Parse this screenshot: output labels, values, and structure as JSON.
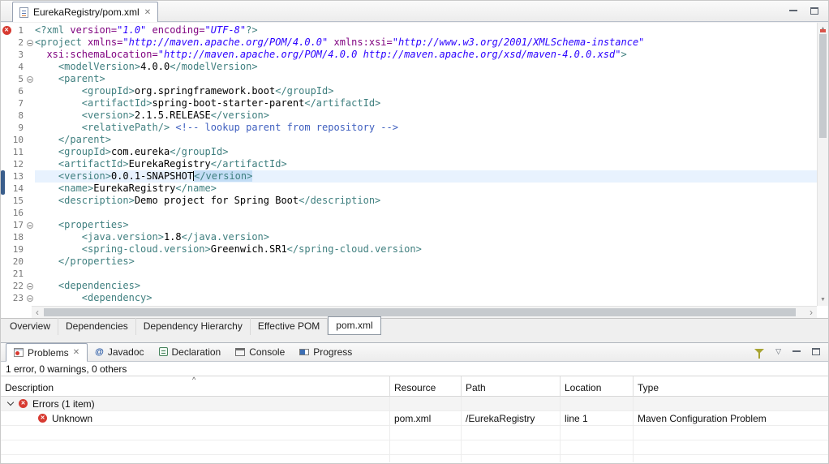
{
  "glyphs": {
    "close": "✕",
    "cross": "✕",
    "up_arrow": "▲",
    "down_arrow": "▼",
    "left_arrow": "‹",
    "right_arrow": "›",
    "sort_asc": "^",
    "at": "@",
    "view_menu": "▽"
  },
  "colors": {
    "tag": "#3F7F7F",
    "attr_name": "#7F007F",
    "attr_value": "#2A00FF",
    "comment": "#3F5FBF",
    "text": "#000000",
    "error": "#d73a31",
    "current_line": "#e8f2fe",
    "occurrence_highlight": "#c3ddf5"
  },
  "editor": {
    "tab_title": "EurekaRegistry/pom.xml",
    "lines": [
      {
        "num": 1,
        "error": true,
        "segments": [
          [
            "t",
            "<?xml "
          ],
          [
            "a",
            "version="
          ],
          [
            "v",
            "\"1.0\""
          ],
          [
            "x",
            " "
          ],
          [
            "a",
            "encoding="
          ],
          [
            "v",
            "\"UTF-8\""
          ],
          [
            "t",
            "?>"
          ]
        ]
      },
      {
        "num": 2,
        "fold": true,
        "segments": [
          [
            "t",
            "<project "
          ],
          [
            "a",
            "xmlns="
          ],
          [
            "v",
            "\"http://maven.apache.org/POM/4.0.0\""
          ],
          [
            "x",
            " "
          ],
          [
            "a",
            "xmlns:xsi="
          ],
          [
            "v",
            "\"http://www.w3.org/2001/XMLSchema-instance\""
          ]
        ]
      },
      {
        "num": 3,
        "segments": [
          [
            "x",
            "  "
          ],
          [
            "a",
            "xsi:schemaLocation="
          ],
          [
            "v",
            "\"http://maven.apache.org/POM/4.0.0 http://maven.apache.org/xsd/maven-4.0.0.xsd\""
          ],
          [
            "t",
            ">"
          ]
        ]
      },
      {
        "num": 4,
        "segments": [
          [
            "x",
            "    "
          ],
          [
            "t",
            "<modelVersion>"
          ],
          [
            "x",
            "4.0.0"
          ],
          [
            "t",
            "</modelVersion>"
          ]
        ]
      },
      {
        "num": 5,
        "fold": true,
        "segments": [
          [
            "x",
            "    "
          ],
          [
            "t",
            "<parent>"
          ]
        ]
      },
      {
        "num": 6,
        "segments": [
          [
            "x",
            "        "
          ],
          [
            "t",
            "<groupId>"
          ],
          [
            "x",
            "org.springframework.boot"
          ],
          [
            "t",
            "</groupId>"
          ]
        ]
      },
      {
        "num": 7,
        "segments": [
          [
            "x",
            "        "
          ],
          [
            "t",
            "<artifactId>"
          ],
          [
            "x",
            "spring-boot-starter-parent"
          ],
          [
            "t",
            "</artifactId>"
          ]
        ]
      },
      {
        "num": 8,
        "segments": [
          [
            "x",
            "        "
          ],
          [
            "t",
            "<version>"
          ],
          [
            "x",
            "2.1.5.RELEASE"
          ],
          [
            "t",
            "</version>"
          ]
        ]
      },
      {
        "num": 9,
        "segments": [
          [
            "x",
            "        "
          ],
          [
            "t",
            "<relativePath/>"
          ],
          [
            "x",
            " "
          ],
          [
            "c",
            "<!-- lookup parent from repository -->"
          ]
        ]
      },
      {
        "num": 10,
        "segments": [
          [
            "x",
            "    "
          ],
          [
            "t",
            "</parent>"
          ]
        ]
      },
      {
        "num": 11,
        "segments": [
          [
            "x",
            "    "
          ],
          [
            "t",
            "<groupId>"
          ],
          [
            "x",
            "com.eureka"
          ],
          [
            "t",
            "</groupId>"
          ]
        ]
      },
      {
        "num": 12,
        "segments": [
          [
            "x",
            "    "
          ],
          [
            "t",
            "<artifactId>"
          ],
          [
            "x",
            "EurekaRegistry"
          ],
          [
            "t",
            "</artifactId>"
          ]
        ]
      },
      {
        "num": 13,
        "current": true,
        "segments": [
          [
            "x",
            "    "
          ],
          [
            "t",
            "<version>"
          ],
          [
            "x",
            "0.0.1-SNAPSHOT"
          ],
          [
            "cursor",
            ""
          ],
          [
            "th",
            "</version>"
          ]
        ]
      },
      {
        "num": 14,
        "segments": [
          [
            "x",
            "    "
          ],
          [
            "t",
            "<name>"
          ],
          [
            "x",
            "EurekaRegistry"
          ],
          [
            "t",
            "</name>"
          ]
        ]
      },
      {
        "num": 15,
        "segments": [
          [
            "x",
            "    "
          ],
          [
            "t",
            "<description>"
          ],
          [
            "x",
            "Demo project for Spring Boot"
          ],
          [
            "t",
            "</description>"
          ]
        ]
      },
      {
        "num": 16,
        "segments": []
      },
      {
        "num": 17,
        "fold": true,
        "segments": [
          [
            "x",
            "    "
          ],
          [
            "t",
            "<properties>"
          ]
        ]
      },
      {
        "num": 18,
        "segments": [
          [
            "x",
            "        "
          ],
          [
            "t",
            "<java.version>"
          ],
          [
            "x",
            "1.8"
          ],
          [
            "t",
            "</java.version>"
          ]
        ]
      },
      {
        "num": 19,
        "segments": [
          [
            "x",
            "        "
          ],
          [
            "t",
            "<spring-cloud.version>"
          ],
          [
            "x",
            "Greenwich.SR1"
          ],
          [
            "t",
            "</spring-cloud.version>"
          ]
        ]
      },
      {
        "num": 20,
        "segments": [
          [
            "x",
            "    "
          ],
          [
            "t",
            "</properties>"
          ]
        ]
      },
      {
        "num": 21,
        "segments": []
      },
      {
        "num": 22,
        "fold": true,
        "segments": [
          [
            "x",
            "    "
          ],
          [
            "t",
            "<dependencies>"
          ]
        ]
      },
      {
        "num": 23,
        "fold": true,
        "segments": [
          [
            "x",
            "        "
          ],
          [
            "t",
            "<dependency>"
          ]
        ]
      }
    ]
  },
  "editor_bottom_tabs": {
    "items": [
      {
        "label": "Overview"
      },
      {
        "label": "Dependencies"
      },
      {
        "label": "Dependency Hierarchy"
      },
      {
        "label": "Effective POM"
      },
      {
        "label": "pom.xml",
        "selected": true
      }
    ]
  },
  "problems_view": {
    "tabs": [
      {
        "label": "Problems",
        "selected": true
      },
      {
        "label": "Javadoc"
      },
      {
        "label": "Declaration"
      },
      {
        "label": "Console"
      },
      {
        "label": "Progress"
      }
    ],
    "summary": "1 error, 0 warnings, 0 others",
    "columns": [
      {
        "label": "Description"
      },
      {
        "label": "Resource"
      },
      {
        "label": "Path"
      },
      {
        "label": "Location"
      },
      {
        "label": "Type"
      }
    ],
    "rows": [
      {
        "kind": "group",
        "expanded": true,
        "description": "Errors (1 item)"
      },
      {
        "kind": "item",
        "description": "Unknown",
        "resource": "pom.xml",
        "path": "/EurekaRegistry",
        "location": "line 1",
        "type": "Maven Configuration Problem"
      }
    ]
  }
}
